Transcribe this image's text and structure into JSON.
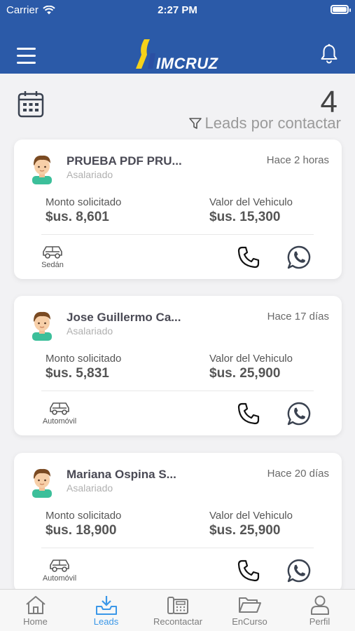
{
  "status_bar": {
    "carrier": "Carrier",
    "time": "2:27 PM"
  },
  "header": {
    "logo_text": "IMCRUZ",
    "colors": {
      "bar": "#2b5aa8",
      "logo_blue": "#2b4fa3",
      "logo_yellow": "#f5d21a"
    }
  },
  "summary": {
    "count": "4",
    "filter_label": "Leads por contactar"
  },
  "leads": [
    {
      "name": "PRUEBA PDF PRU...",
      "job": "Asalariado",
      "time_ago": "Hace 2 horas",
      "monto_label": "Monto solicitado",
      "monto_value": "$us. 8,601",
      "valor_label": "Valor del Vehiculo",
      "valor_value": "$us. 15,300",
      "vehicle_type": "Sedán"
    },
    {
      "name": "Jose Guillermo Ca...",
      "job": "Asalariado",
      "time_ago": "Hace 17 días",
      "monto_label": "Monto solicitado",
      "monto_value": "$us. 5,831",
      "valor_label": "Valor del Vehiculo",
      "valor_value": "$us. 25,900",
      "vehicle_type": "Automóvil"
    },
    {
      "name": "Mariana Ospina S...",
      "job": "Asalariado",
      "time_ago": "Hace 20 días",
      "monto_label": "Monto solicitado",
      "monto_value": "$us. 18,900",
      "valor_label": "Valor del Vehiculo",
      "valor_value": "$us. 25,900",
      "vehicle_type": "Automóvil"
    }
  ],
  "tabs": [
    {
      "label": "Home",
      "icon": "home-icon",
      "active": false
    },
    {
      "label": "Leads",
      "icon": "inbox-download-icon",
      "active": true
    },
    {
      "label": "Recontactar",
      "icon": "fax-phone-icon",
      "active": false
    },
    {
      "label": "EnCurso",
      "icon": "folder-open-icon",
      "active": false
    },
    {
      "label": "Perfil",
      "icon": "user-icon",
      "active": false
    }
  ],
  "colors": {
    "active_tab": "#3a97e8",
    "inactive_tab": "#7d7d7d"
  }
}
